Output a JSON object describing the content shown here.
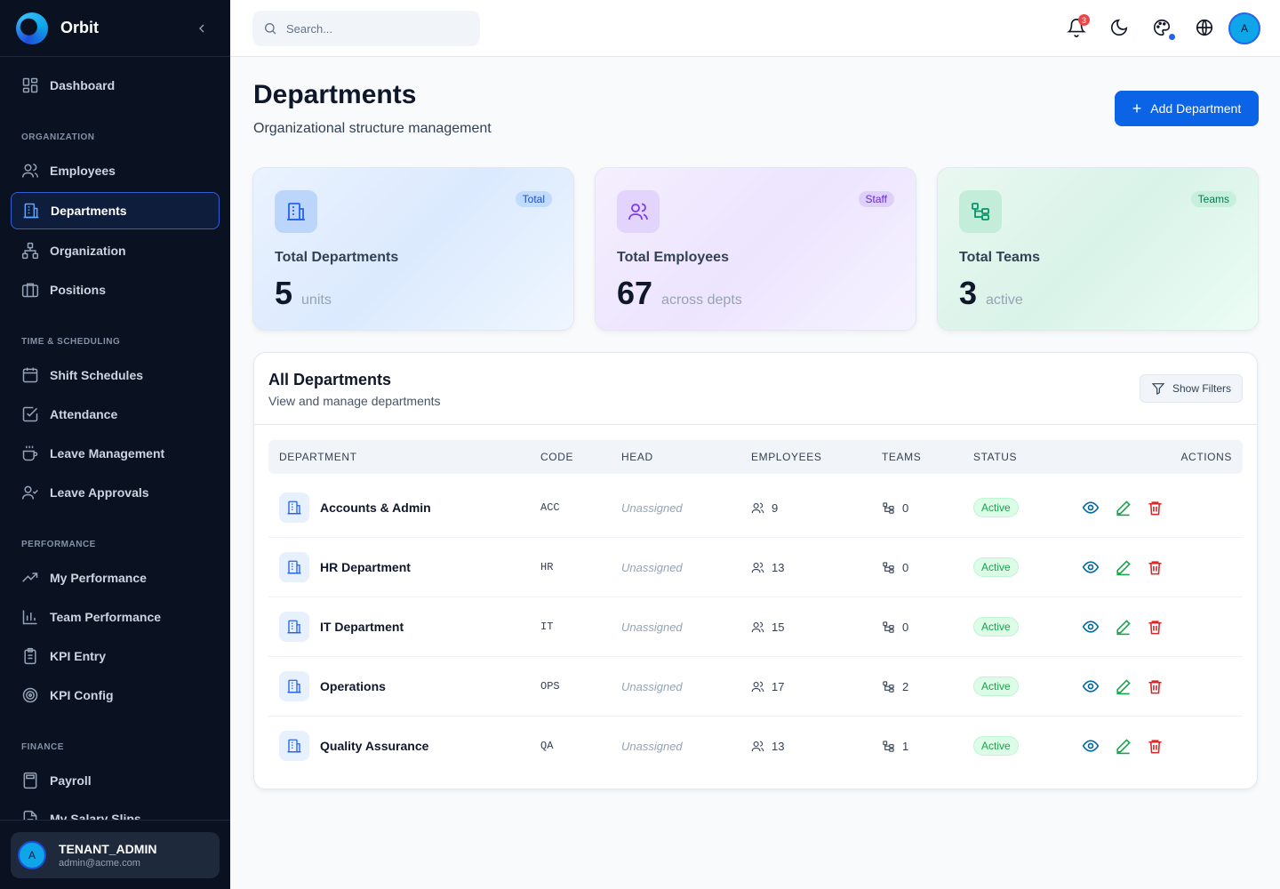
{
  "app": {
    "name": "Orbit"
  },
  "sidebar": {
    "dashboard": "Dashboard",
    "sections": {
      "organization": "ORGANIZATION",
      "time": "TIME & SCHEDULING",
      "performance": "PERFORMANCE",
      "finance": "FINANCE"
    },
    "items": {
      "employees": "Employees",
      "departments": "Departments",
      "organization": "Organization",
      "positions": "Positions",
      "shift_schedules": "Shift Schedules",
      "attendance": "Attendance",
      "leave_management": "Leave Management",
      "leave_approvals": "Leave Approvals",
      "my_performance": "My Performance",
      "team_performance": "Team Performance",
      "kpi_entry": "KPI Entry",
      "kpi_config": "KPI Config",
      "payroll": "Payroll",
      "my_salary_slips": "My Salary Slips"
    },
    "active": "Departments",
    "user": {
      "initial": "A",
      "role": "TENANT_ADMIN",
      "email": "admin@acme.com"
    }
  },
  "topbar": {
    "search_placeholder": "Search...",
    "notification_count": "3",
    "avatar_initial": "A"
  },
  "header": {
    "title": "Departments",
    "subtitle": "Organizational structure management",
    "add_button": "Add Department"
  },
  "stats": [
    {
      "chip": "Total",
      "label": "Total Departments",
      "value": "5",
      "unit": "units"
    },
    {
      "chip": "Staff",
      "label": "Total Employees",
      "value": "67",
      "unit": "across depts"
    },
    {
      "chip": "Teams",
      "label": "Total Teams",
      "value": "3",
      "unit": "active"
    }
  ],
  "table": {
    "title": "All Departments",
    "subtitle": "View and manage departments",
    "filter_button": "Show Filters",
    "columns": {
      "department": "DEPARTMENT",
      "code": "CODE",
      "head": "HEAD",
      "employees": "EMPLOYEES",
      "teams": "TEAMS",
      "status": "STATUS",
      "actions": "ACTIONS"
    },
    "rows": [
      {
        "name": "Accounts & Admin",
        "code": "ACC",
        "head": "Unassigned",
        "employees": "9",
        "teams": "0",
        "status": "Active"
      },
      {
        "name": "HR Department",
        "code": "HR",
        "head": "Unassigned",
        "employees": "13",
        "teams": "0",
        "status": "Active"
      },
      {
        "name": "IT Department",
        "code": "IT",
        "head": "Unassigned",
        "employees": "15",
        "teams": "0",
        "status": "Active"
      },
      {
        "name": "Operations",
        "code": "OPS",
        "head": "Unassigned",
        "employees": "17",
        "teams": "2",
        "status": "Active"
      },
      {
        "name": "Quality Assurance",
        "code": "QA",
        "head": "Unassigned",
        "employees": "13",
        "teams": "1",
        "status": "Active"
      }
    ]
  },
  "colors": {
    "primary": "#0b63e5",
    "sidebar_bg": "#0a1120",
    "success": "#16a34a",
    "danger": "#dc2626"
  }
}
